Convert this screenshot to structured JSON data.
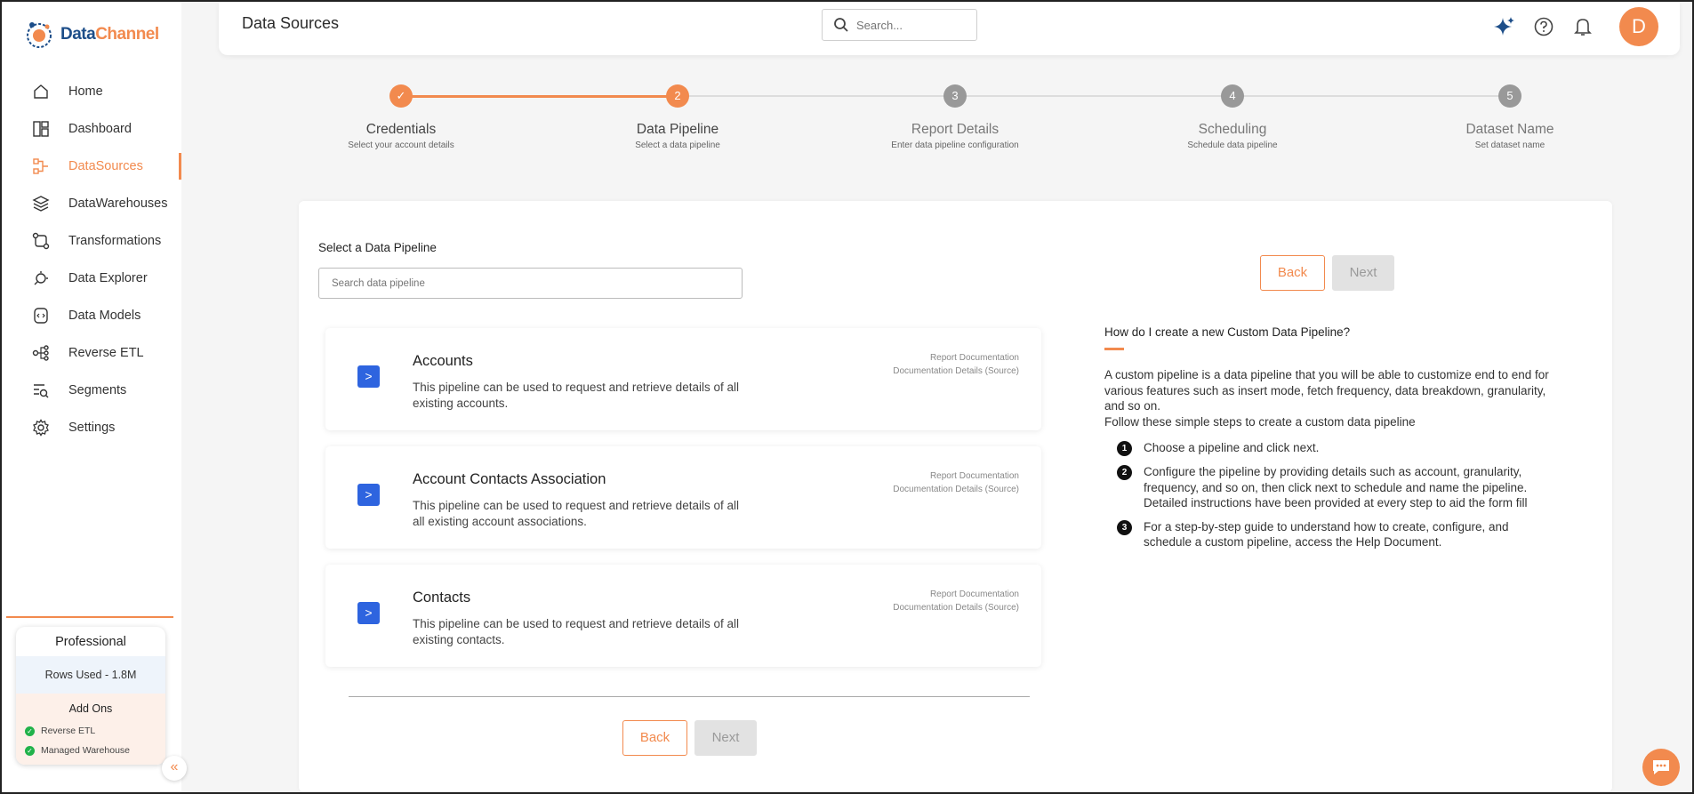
{
  "brand": {
    "name_part1": "Data",
    "name_part2": "Channel"
  },
  "sidebar": {
    "items": [
      {
        "label": "Home",
        "icon": "home-icon"
      },
      {
        "label": "Dashboard",
        "icon": "dashboard-icon"
      },
      {
        "label": "DataSources",
        "icon": "datasources-icon",
        "active": true
      },
      {
        "label": "DataWarehouses",
        "icon": "layers-icon"
      },
      {
        "label": "Transformations",
        "icon": "transform-icon"
      },
      {
        "label": "Data Explorer",
        "icon": "explorer-icon"
      },
      {
        "label": "Data Models",
        "icon": "models-icon"
      },
      {
        "label": "Reverse ETL",
        "icon": "reverse-etl-icon"
      },
      {
        "label": "Segments",
        "icon": "segments-icon"
      },
      {
        "label": "Settings",
        "icon": "gear-icon"
      }
    ],
    "plan": {
      "title": "Professional",
      "rows_used": "Rows Used - 1.8M",
      "addons_title": "Add Ons",
      "addons": [
        "Reverse ETL",
        "Managed Warehouse"
      ]
    },
    "collapse_glyph": "«"
  },
  "header": {
    "title": "Data Sources",
    "search_placeholder": "Search...",
    "avatar_letter": "D"
  },
  "stepper": {
    "steps": [
      {
        "number": "✓",
        "label": "Credentials",
        "sub": "Select your account details",
        "state": "done"
      },
      {
        "number": "2",
        "label": "Data Pipeline",
        "sub": "Select a data pipeline",
        "state": "active"
      },
      {
        "number": "3",
        "label": "Report Details",
        "sub": "Enter data pipeline configuration",
        "state": "pending"
      },
      {
        "number": "4",
        "label": "Scheduling",
        "sub": "Schedule data pipeline",
        "state": "pending"
      },
      {
        "number": "5",
        "label": "Dataset Name",
        "sub": "Set dataset name",
        "state": "pending"
      }
    ]
  },
  "main": {
    "select_label": "Select a Data Pipeline",
    "search_placeholder": "Search data pipeline",
    "back_label": "Back",
    "next_label": "Next",
    "pipelines": [
      {
        "title": "Accounts",
        "description": "This pipeline can be used to request and retrieve details of all existing accounts.",
        "link1": "Report Documentation",
        "link2": "Documentation Details (Source)"
      },
      {
        "title": "Account Contacts Association",
        "description": "This pipeline can be used to request and retrieve details of all all existing account associations.",
        "link1": "Report Documentation",
        "link2": "Documentation Details (Source)"
      },
      {
        "title": "Contacts",
        "description": "This pipeline can be used to request and retrieve details of all existing contacts.",
        "link1": "Report Documentation",
        "link2": "Documentation Details (Source)"
      }
    ]
  },
  "help": {
    "title": "How do I create a new Custom Data Pipeline?",
    "paragraph1": "A custom pipeline is a data pipeline that you will be able to customize end to end for various features such as insert mode, fetch frequency, data breakdown, granularity, and so on.",
    "paragraph2": "Follow these simple steps to create a custom data pipeline",
    "steps": [
      {
        "num": "1",
        "text": "Choose a pipeline and click next."
      },
      {
        "num": "2",
        "text": "Configure the pipeline by providing details such as account, granularity, frequency, and so on, then click next to schedule and name the pipeline. Detailed instructions have been provided at every step to aid the form fill"
      },
      {
        "num": "3",
        "text": "For a step-by-step guide to understand how to create, configure, and schedule a custom pipeline, access the Help Document."
      }
    ]
  },
  "colors": {
    "accent": "#f28a4e",
    "brand_blue": "#1d4e89",
    "card_icon": "#2e64df"
  }
}
